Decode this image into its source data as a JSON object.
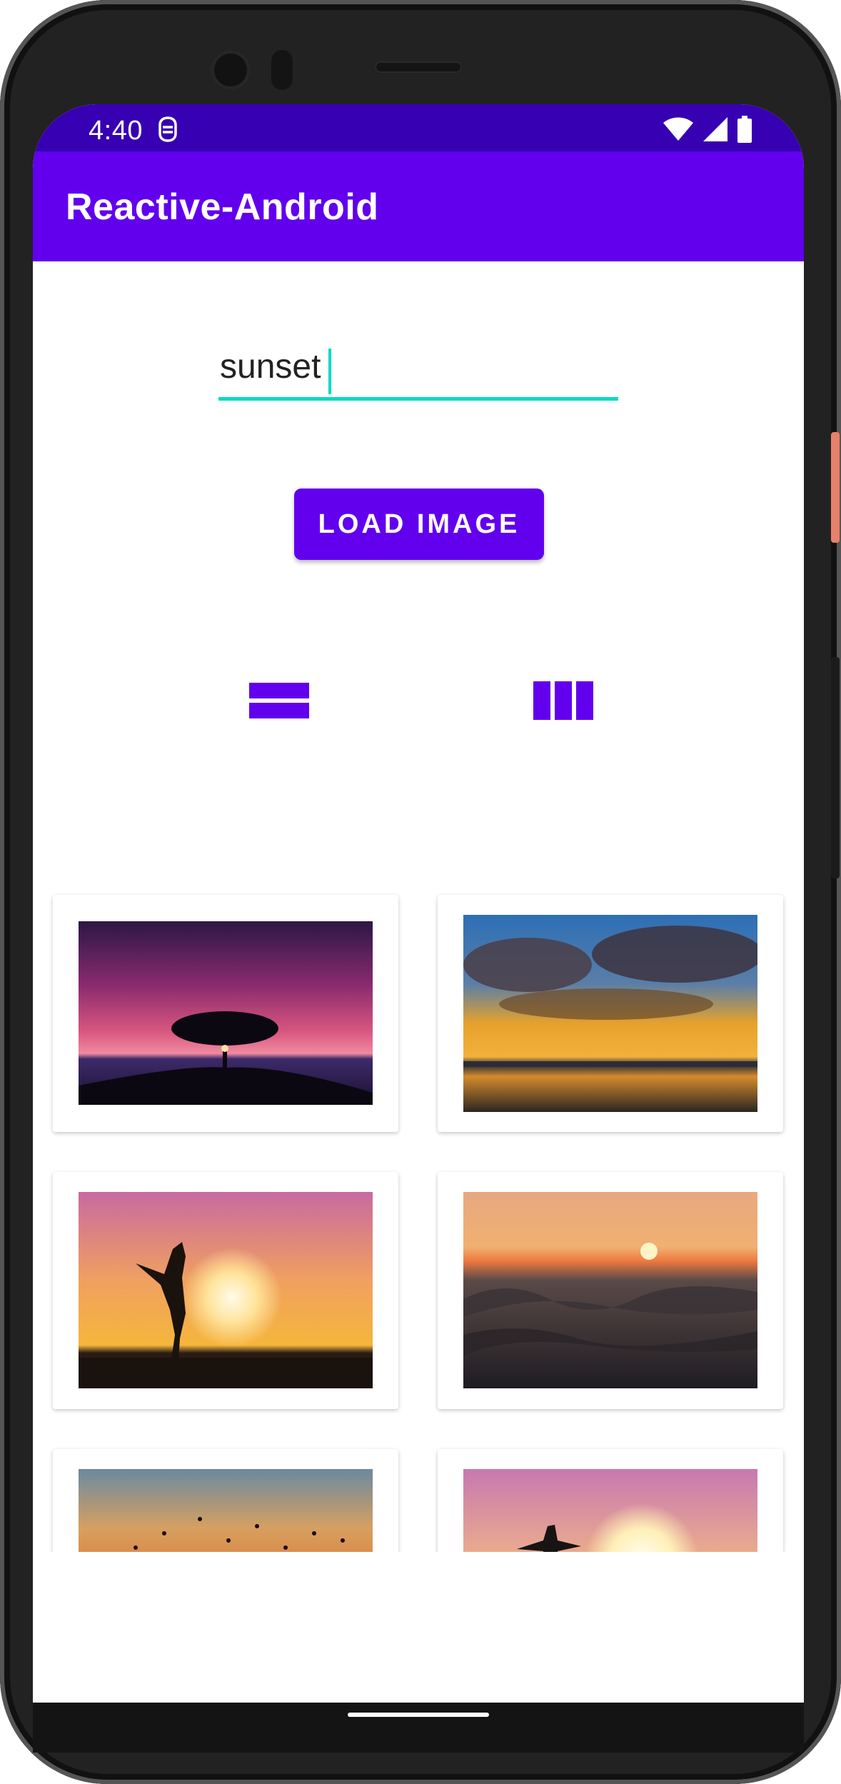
{
  "status_bar": {
    "time": "4:40",
    "icons": [
      "dnd-icon",
      "wifi-icon",
      "signal-icon",
      "battery-icon"
    ]
  },
  "app_bar": {
    "title": "Reactive-Android"
  },
  "search": {
    "value": "sunset"
  },
  "load_button": {
    "label": "LOAD IMAGE"
  },
  "layout_toggle": [
    "list-layout-icon",
    "grid-layout-icon"
  ],
  "images": [
    {
      "name": "sunset-tree-thumbnail"
    },
    {
      "name": "sunset-clouds-lake-thumbnail"
    },
    {
      "name": "sunset-woman-silhouette-thumbnail"
    },
    {
      "name": "sunset-ocean-waves-thumbnail"
    },
    {
      "name": "sunset-birds-sky-thumbnail"
    },
    {
      "name": "sunset-pier-woman-thumbnail"
    }
  ],
  "colors": {
    "primary": "#6200ee",
    "primary_dark": "#3700b3",
    "accent": "#03dac5"
  }
}
